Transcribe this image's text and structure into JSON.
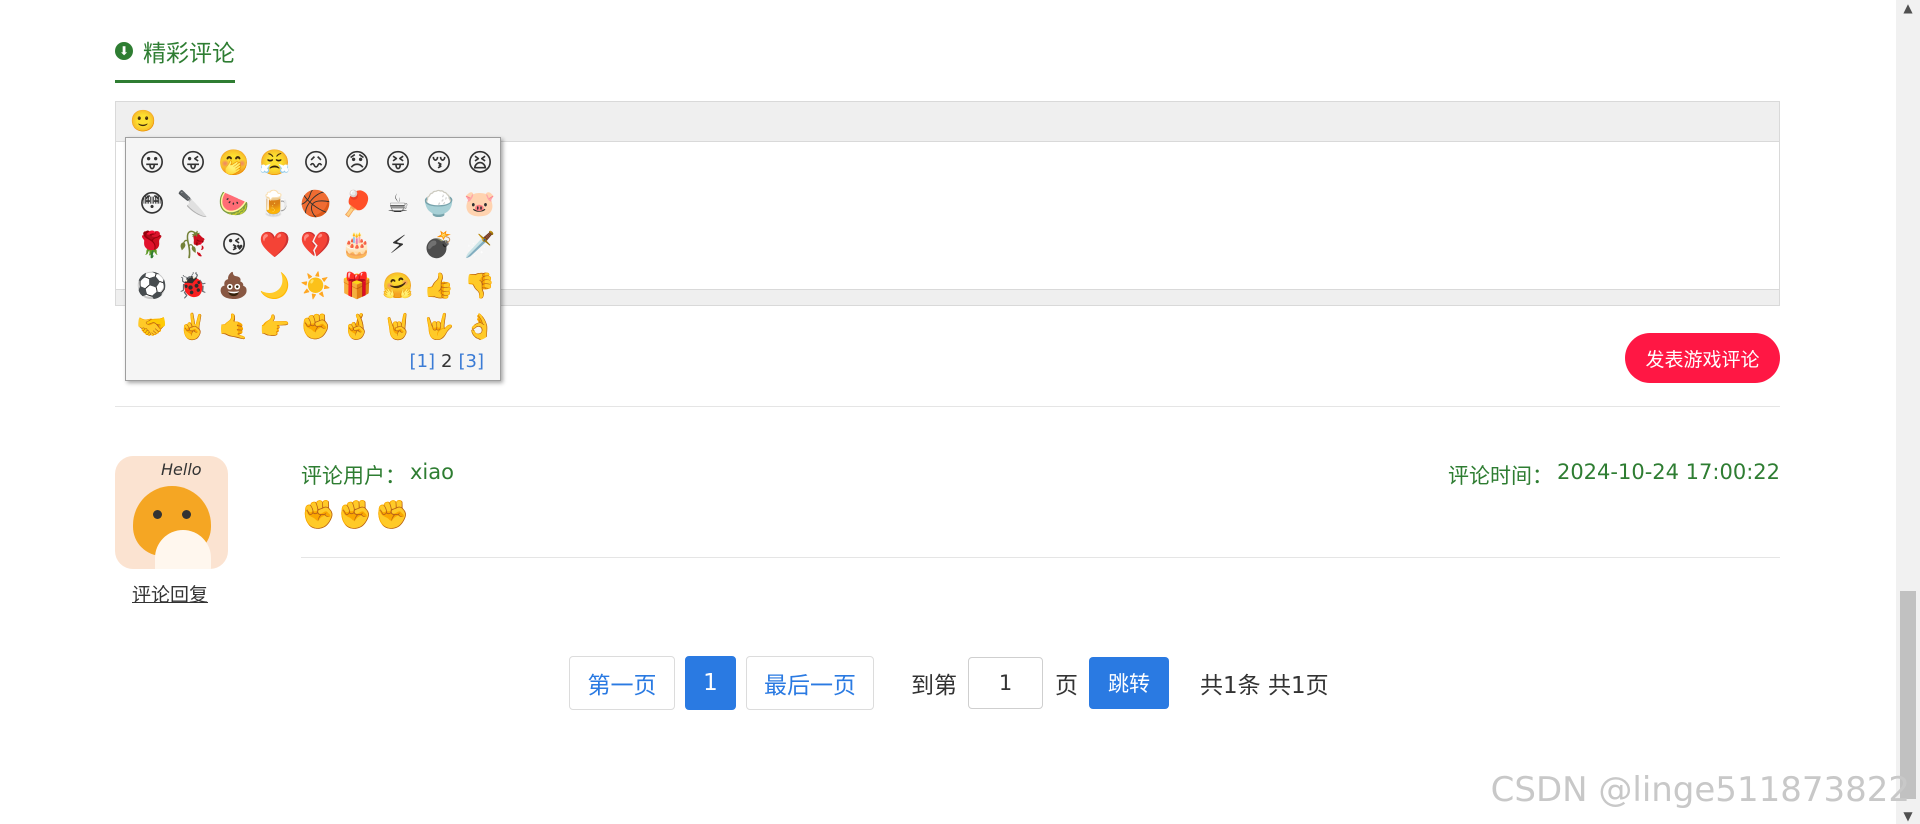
{
  "section": {
    "title": "精彩评论",
    "icon": "download-circle-icon"
  },
  "editor": {
    "emoji_button_icon": "🙂"
  },
  "emoji_panel": {
    "emojis": [
      "😛",
      "😜",
      "🤭",
      "😤",
      "😖",
      "😞",
      "😝",
      "😚",
      "😫",
      "😳",
      "🔪",
      "🍉",
      "🍺",
      "🏀",
      "🏓",
      "☕",
      "🍚",
      "🐷",
      "🌹",
      "🥀",
      "😘",
      "❤️",
      "💔",
      "🎂",
      "⚡",
      "💣",
      "🗡️",
      "⚽",
      "🐞",
      "💩",
      "🌙",
      "☀️",
      "🎁",
      "🤗",
      "👍",
      "👎",
      "🤝",
      "✌️",
      "🤙",
      "👉",
      "✊",
      "🤞",
      "🤘",
      "🤟",
      "👌"
    ],
    "pages": [
      "[1]",
      "2",
      "[3]"
    ]
  },
  "submit_label": "发表游戏评论",
  "comment": {
    "avatar_text": "Hello",
    "reply_label": "评论回复",
    "user_label": "评论用户：",
    "user": "xiao",
    "time_label": "评论时间：",
    "time": "2024-10-24 17:00:22",
    "content": "✊✊✊"
  },
  "pagination": {
    "first": "第一页",
    "current": "1",
    "last": "最后一页",
    "goto_label": "到第",
    "goto_value": "1",
    "page_unit": "页",
    "go": "跳转",
    "total": "共1条 共1页"
  },
  "watermark": "CSDN @linge511873822",
  "colors": {
    "accent": "#2e7d32",
    "primary": "#2a7ae2",
    "submit": "#ff1744"
  }
}
